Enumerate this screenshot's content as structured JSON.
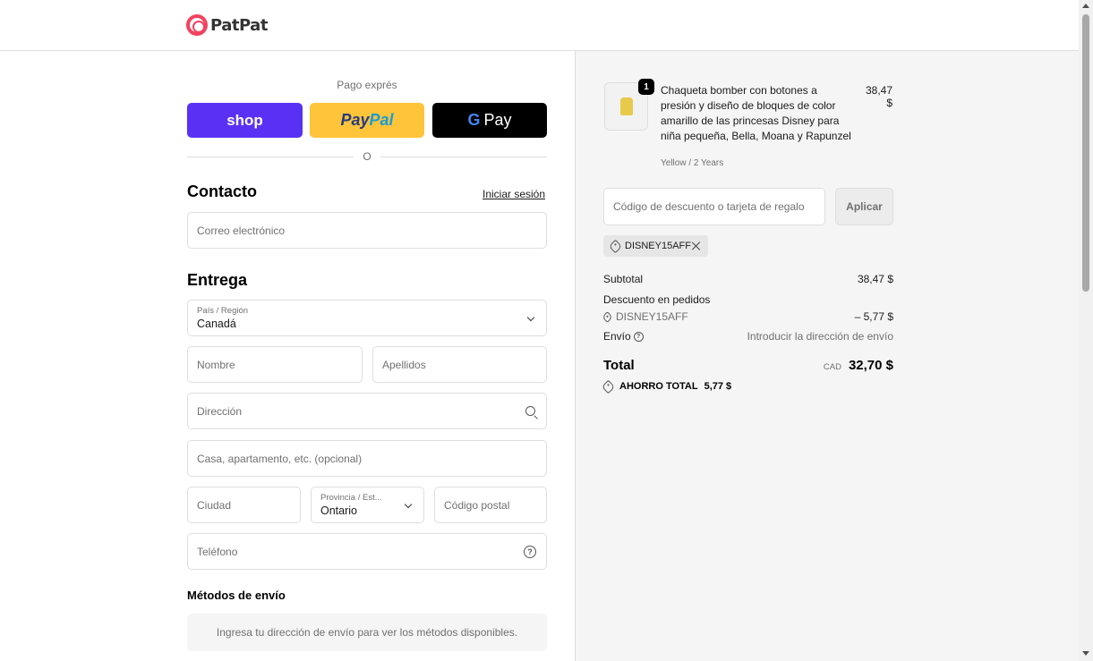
{
  "brand": {
    "name": "PatPat",
    "accent": "#f3425f"
  },
  "express": {
    "title": "Pago exprés",
    "shop_label": "shop",
    "paypal_label_a": "Pay",
    "paypal_label_b": "Pal",
    "gpay_g": "G",
    "gpay_label": "Pay",
    "or": "O"
  },
  "contact": {
    "title": "Contacto",
    "login_link": "Iniciar sesión",
    "email_placeholder": "Correo electrónico"
  },
  "delivery": {
    "title": "Entrega",
    "country_label": "País / Región",
    "country_value": "Canadá",
    "first_name": "Nombre",
    "last_name": "Apellidos",
    "address": "Dirección",
    "apartment": "Casa, apartamento, etc. (opcional)",
    "city": "Ciudad",
    "province_label": "Provincia / Est...",
    "province_value": "Ontario",
    "postal": "Código postal",
    "phone": "Teléfono",
    "help_icon": "?"
  },
  "shipping": {
    "title": "Métodos de envío",
    "message": "Ingresa tu dirección de envío para ver los métodos disponibles."
  },
  "cart": {
    "quantity": "1",
    "product_title": "Chaqueta bomber con botones a presión y diseño de bloques de color amarillo de las princesas Disney para niña pequeña, Bella, Moana y Rapunzel",
    "variant": "Yellow / 2 Years",
    "price": "38,47 $"
  },
  "discount": {
    "placeholder": "Código de descuento o tarjeta de regalo",
    "apply": "Aplicar",
    "applied_code": "DISNEY15AFF"
  },
  "summary": {
    "subtotal_label": "Subtotal",
    "subtotal_value": "38,47 $",
    "order_discount_label": "Descuento en pedidos",
    "code": "DISNEY15AFF",
    "code_value": "– 5,77 $",
    "shipping_label": "Envío",
    "shipping_value": "Introducir la dirección de envío",
    "info_icon": "?",
    "total_label": "Total",
    "currency": "CAD",
    "total_value": "32,70 $",
    "savings_label": "AHORRO TOTAL",
    "savings_value": "5,77 $"
  }
}
